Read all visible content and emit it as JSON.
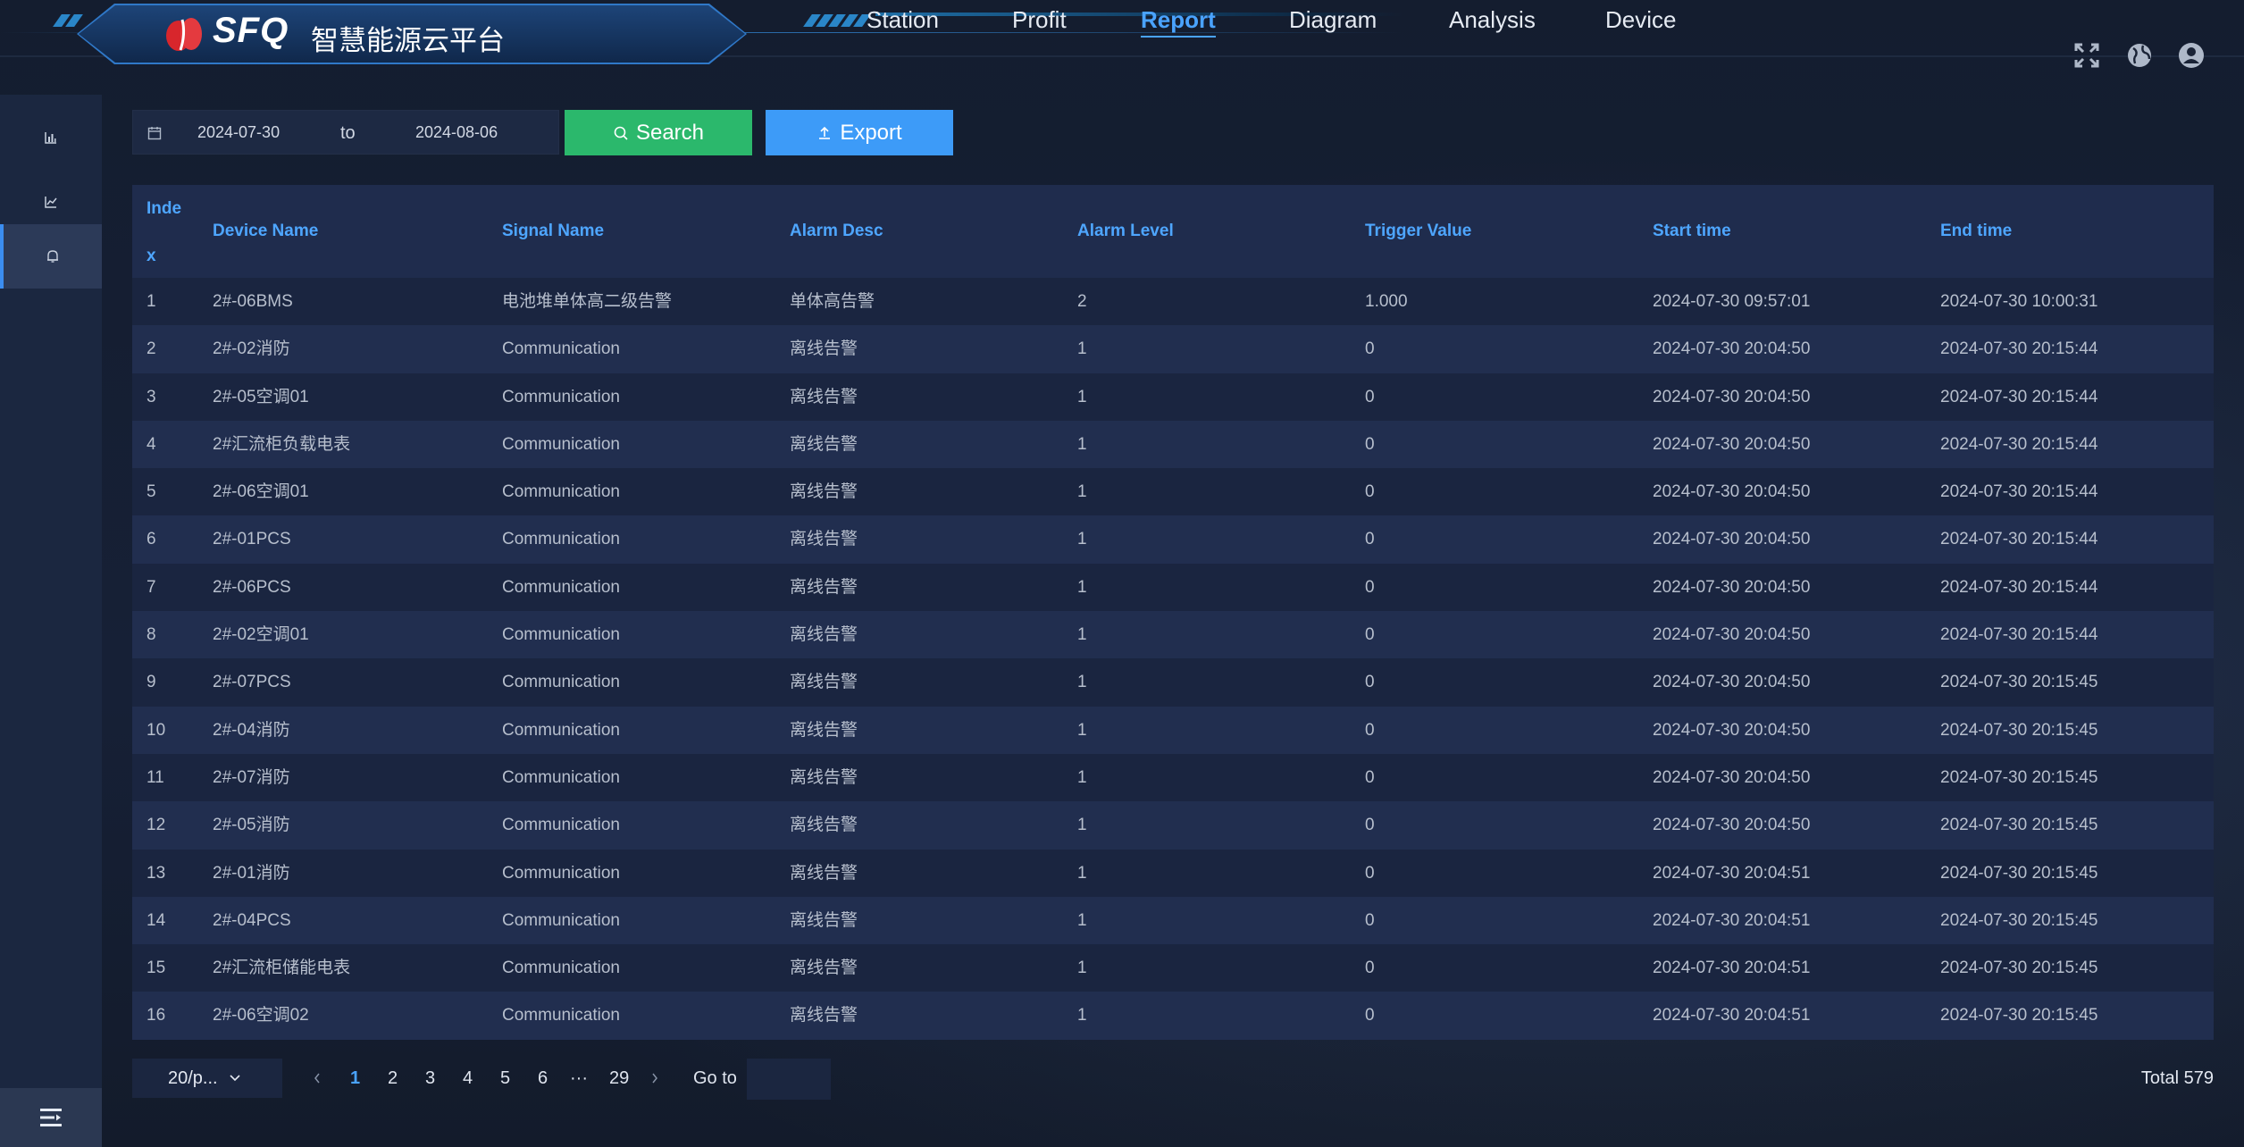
{
  "app": {
    "brand": "SFQ",
    "title_cn": "智慧能源云平台"
  },
  "nav": {
    "items": [
      "Station",
      "Profit",
      "Report",
      "Diagram",
      "Analysis",
      "Device"
    ],
    "active": "Report"
  },
  "header_icons": [
    "fullscreen-icon",
    "globe-icon",
    "user-icon"
  ],
  "sidebar": {
    "items": [
      "bar-chart-icon",
      "line-chart-icon",
      "bell-icon"
    ],
    "active_index": 2,
    "bottom_icon": "collapse-menu-icon"
  },
  "filters": {
    "start_date": "2024-07-30",
    "separator": "to",
    "end_date": "2024-08-06",
    "search_label": "Search",
    "export_label": "Export"
  },
  "colors": {
    "accent": "#4aa3ff",
    "search": "#2bb86c",
    "export": "#3d9bf8"
  },
  "table": {
    "headers": {
      "index_line1": "Inde",
      "index_line2": "x",
      "device": "Device Name",
      "signal": "Signal Name",
      "desc": "Alarm Desc",
      "level": "Alarm Level",
      "trigger": "Trigger Value",
      "start": "Start time",
      "end": "End time"
    },
    "rows": [
      [
        "1",
        "2#-06BMS",
        "电池堆单体高二级告警",
        "单体高告警",
        "2",
        "1.000",
        "2024-07-30 09:57:01",
        "2024-07-30 10:00:31"
      ],
      [
        "2",
        "2#-02消防",
        "Communication",
        "离线告警",
        "1",
        "0",
        "2024-07-30 20:04:50",
        "2024-07-30 20:15:44"
      ],
      [
        "3",
        "2#-05空调01",
        "Communication",
        "离线告警",
        "1",
        "0",
        "2024-07-30 20:04:50",
        "2024-07-30 20:15:44"
      ],
      [
        "4",
        "2#汇流柜负载电表",
        "Communication",
        "离线告警",
        "1",
        "0",
        "2024-07-30 20:04:50",
        "2024-07-30 20:15:44"
      ],
      [
        "5",
        "2#-06空调01",
        "Communication",
        "离线告警",
        "1",
        "0",
        "2024-07-30 20:04:50",
        "2024-07-30 20:15:44"
      ],
      [
        "6",
        "2#-01PCS",
        "Communication",
        "离线告警",
        "1",
        "0",
        "2024-07-30 20:04:50",
        "2024-07-30 20:15:44"
      ],
      [
        "7",
        "2#-06PCS",
        "Communication",
        "离线告警",
        "1",
        "0",
        "2024-07-30 20:04:50",
        "2024-07-30 20:15:44"
      ],
      [
        "8",
        "2#-02空调01",
        "Communication",
        "离线告警",
        "1",
        "0",
        "2024-07-30 20:04:50",
        "2024-07-30 20:15:44"
      ],
      [
        "9",
        "2#-07PCS",
        "Communication",
        "离线告警",
        "1",
        "0",
        "2024-07-30 20:04:50",
        "2024-07-30 20:15:45"
      ],
      [
        "10",
        "2#-04消防",
        "Communication",
        "离线告警",
        "1",
        "0",
        "2024-07-30 20:04:50",
        "2024-07-30 20:15:45"
      ],
      [
        "11",
        "2#-07消防",
        "Communication",
        "离线告警",
        "1",
        "0",
        "2024-07-30 20:04:50",
        "2024-07-30 20:15:45"
      ],
      [
        "12",
        "2#-05消防",
        "Communication",
        "离线告警",
        "1",
        "0",
        "2024-07-30 20:04:50",
        "2024-07-30 20:15:45"
      ],
      [
        "13",
        "2#-01消防",
        "Communication",
        "离线告警",
        "1",
        "0",
        "2024-07-30 20:04:51",
        "2024-07-30 20:15:45"
      ],
      [
        "14",
        "2#-04PCS",
        "Communication",
        "离线告警",
        "1",
        "0",
        "2024-07-30 20:04:51",
        "2024-07-30 20:15:45"
      ],
      [
        "15",
        "2#汇流柜储能电表",
        "Communication",
        "离线告警",
        "1",
        "0",
        "2024-07-30 20:04:51",
        "2024-07-30 20:15:45"
      ],
      [
        "16",
        "2#-06空调02",
        "Communication",
        "离线告警",
        "1",
        "0",
        "2024-07-30 20:04:51",
        "2024-07-30 20:15:45"
      ]
    ]
  },
  "pagination": {
    "page_size": "20/p...",
    "pages": [
      "1",
      "2",
      "3",
      "4",
      "5",
      "6",
      "···",
      "29"
    ],
    "current": "1",
    "goto_label": "Go to",
    "total": "Total 579"
  }
}
